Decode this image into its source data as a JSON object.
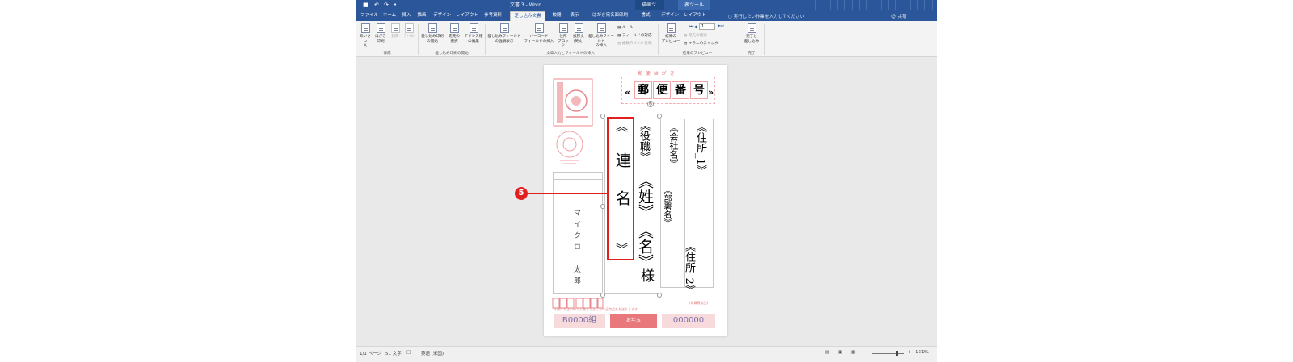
{
  "titlebar": {
    "quick_access": [
      "■",
      "↶",
      "↷",
      "•"
    ],
    "doc_title": "文書 3  -  Word",
    "context_tab_1": "描画ツール",
    "context_tab_2": "表ツール"
  },
  "tabs": [
    {
      "label": "ファイル"
    },
    {
      "label": "ホーム"
    },
    {
      "label": "挿入"
    },
    {
      "label": "描画"
    },
    {
      "label": "デザイン"
    },
    {
      "label": "レイアウト"
    },
    {
      "label": "参考資料"
    },
    {
      "label": "差し込み文書"
    },
    {
      "label": "校閲"
    },
    {
      "label": "表示"
    },
    {
      "label": "はがき宛名面印刷"
    },
    {
      "label": "書式"
    },
    {
      "label": "デザイン"
    },
    {
      "label": "レイアウト"
    }
  ],
  "tell_me": "実行したい作業を入力してください",
  "share": "共有",
  "ribbon": {
    "btn_greeting": "あいさつ\n文",
    "btn_hagaki": "はがき\n印刷",
    "btn_envelope": "封筒",
    "btn_label": "ラベル",
    "group_create": "作成",
    "btn_start_merge": "差し込み印刷\nの開始",
    "btn_recipients": "宛先の\n選択",
    "btn_edit_list": "アドレス帳\nの編集",
    "group_start": "差し込み印刷の開始",
    "btn_highlight": "差し込みフィールド\nの強調表示",
    "btn_barcode": "バーコード\nフィールドの挿入",
    "btn_address": "住所\nブロック",
    "btn_greeting_en": "挨拶文\n(英文)",
    "btn_insert_field": "差し込みフィールド\nの挿入",
    "small_rule": "ルール",
    "small_match": "フィールドの対応",
    "small_update": "複数ラベルに反映",
    "group_fields": "文章入力とフィールドの挿入",
    "btn_preview": "結果の\nプレビュー",
    "record": "1",
    "small_find": "宛先の検索",
    "small_check": "エラーのチェック",
    "group_preview": "結果のプレビュー",
    "btn_finish": "完了と\n差し込み",
    "group_finish": "完了"
  },
  "postcard": {
    "header": "郵 便 は が き",
    "zip_open": "«",
    "zip_chars": [
      "郵",
      "便",
      "番",
      "号"
    ],
    "zip_close": "»",
    "renmei_open": "《",
    "renmei_text": "連名",
    "renmei_close": "》",
    "yakushoku": "《役職》",
    "sei": "《姓》",
    "mei": "《名》",
    "sama": "様",
    "kaisha": "《会社名》",
    "busho": "《部署名》",
    "jusho1": "《住所_1》",
    "jusho2": "《住所_2》",
    "sender_name": "マイクロ　太郎",
    "notice_small": "(年賀専用品)",
    "notice_line": "年賀はがきの中で入賞した方にお年玉商品をお送りします",
    "lottery_group": "B0000組",
    "lottery_number": "000000",
    "badge": "お年玉"
  },
  "callout": "5",
  "statusbar": {
    "page": "1/1 ページ",
    "words": "51 文字",
    "lang": "英語 (米国)",
    "zoom": "131%"
  }
}
